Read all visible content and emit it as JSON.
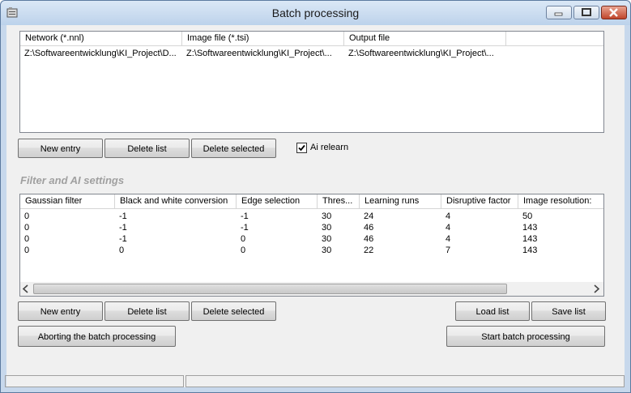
{
  "window": {
    "title": "Batch processing"
  },
  "files": {
    "columns": [
      "Network (*.nnl)",
      "Image file (*.tsi)",
      "Output file"
    ],
    "rows": [
      [
        "Z:\\Softwareentwicklung\\KI_Project\\D...",
        "Z:\\Softwareentwicklung\\KI_Project\\...",
        "Z:\\Softwareentwicklung\\KI_Project\\..."
      ]
    ]
  },
  "files_buttons": {
    "new_entry": "New entry",
    "delete_list": "Delete list",
    "delete_selected": "Delete selected"
  },
  "ai_relearn": {
    "label": "Ai relearn",
    "checked": true
  },
  "settings_section_title": "Filter and AI settings",
  "settings": {
    "columns": [
      "Gaussian filter",
      "Black and white conversion",
      "Edge selection",
      "Thres...",
      "Learning runs",
      "Disruptive factor",
      "Image resolution:"
    ],
    "rows": [
      [
        "0",
        "-1",
        "-1",
        "30",
        "24",
        "4",
        "50"
      ],
      [
        "0",
        "-1",
        "-1",
        "30",
        "46",
        "4",
        "143"
      ],
      [
        "0",
        "-1",
        "0",
        "30",
        "46",
        "4",
        "143"
      ],
      [
        "0",
        "0",
        "0",
        "30",
        "22",
        "7",
        "143"
      ]
    ]
  },
  "settings_buttons": {
    "new_entry": "New entry",
    "delete_list": "Delete list",
    "delete_selected": "Delete selected",
    "load_list": "Load list",
    "save_list": "Save list",
    "abort": "Aborting the batch processing",
    "start": "Start batch processing"
  },
  "status": {
    "pane1": "",
    "pane2": ""
  }
}
